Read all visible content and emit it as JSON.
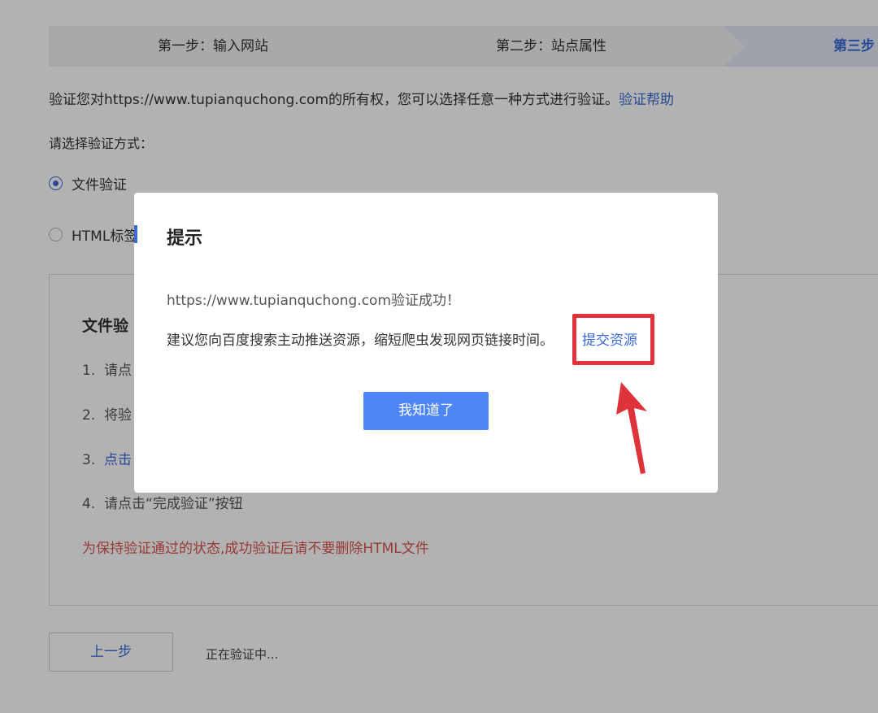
{
  "steps": [
    {
      "label": "第一步：输入网站"
    },
    {
      "label": "第二步：站点属性"
    },
    {
      "label": "第三步"
    }
  ],
  "intro": {
    "text": "验证您对https://www.tupianquchong.com的所有权，您可以选择任意一种方式进行验证。",
    "help_link": "验证帮助"
  },
  "choose_label": "请选择验证方式：",
  "methods": [
    {
      "label": "文件验证",
      "checked": true
    },
    {
      "label": "HTML标签",
      "checked": false
    }
  ],
  "panel": {
    "title": "文件验",
    "steps": [
      {
        "num": "1.",
        "text": "请点"
      },
      {
        "num": "2.",
        "text": "将验"
      },
      {
        "num": "3.",
        "text": "点击"
      },
      {
        "num": "4.",
        "text": "请点击“完成验证”按钮"
      }
    ],
    "warning": "为保持验证通过的状态,成功验证后请不要删除HTML文件"
  },
  "footer": {
    "prev_label": "上一步",
    "status": "正在验证中..."
  },
  "modal": {
    "title": "提示",
    "message1": "https://www.tupianquchong.com验证成功！",
    "message2": "建议您向百度搜索主动推送资源，缩短爬虫发现网页链接时间。",
    "submit_link": "提交资源",
    "ok_label": "我知道了"
  },
  "colors": {
    "accent": "#3a6ad6",
    "primary_button": "#4e86f7",
    "warning": "#d9534f",
    "annotation": "#e0323a"
  }
}
